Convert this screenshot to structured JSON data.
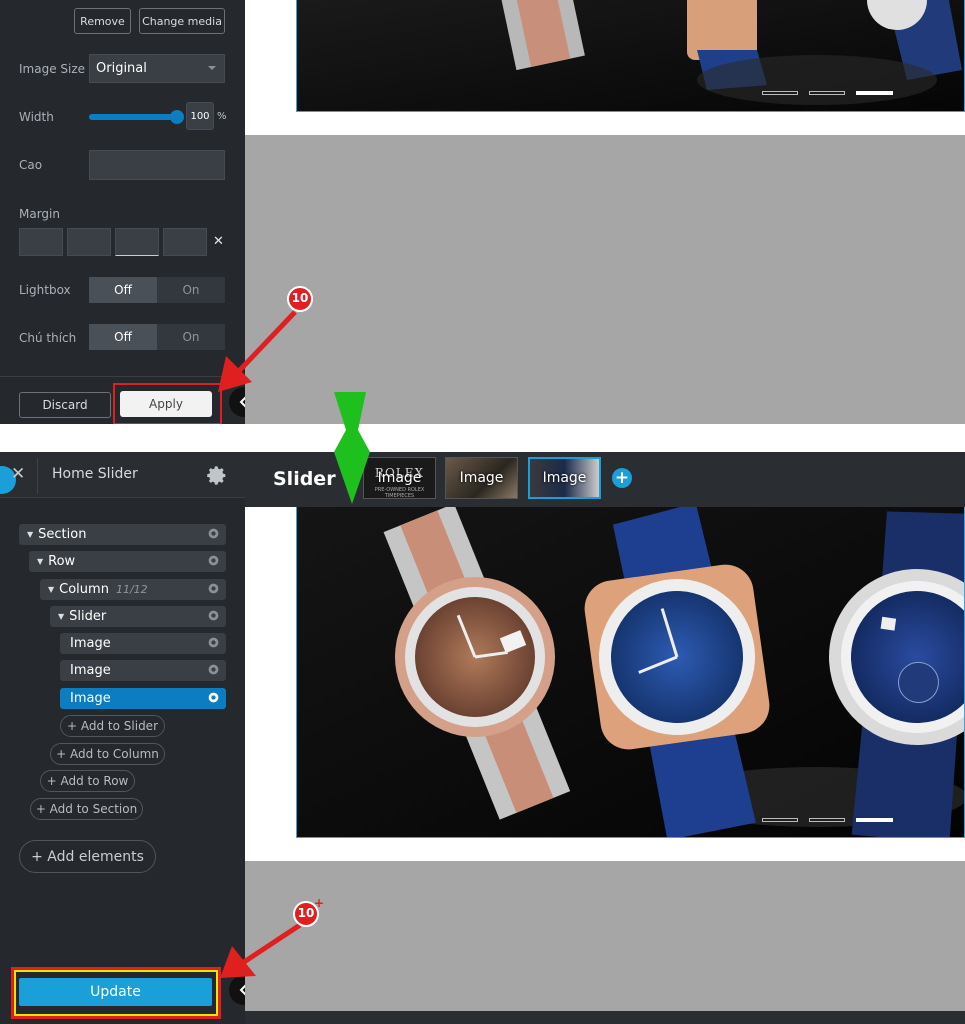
{
  "top_panel": {
    "remove_label": "Remove",
    "change_media_label": "Change media",
    "image_size_label": "Image Size",
    "image_size_value": "Original",
    "width_label": "Width",
    "width_value": "100",
    "width_unit": "%",
    "width_fraction": 1.0,
    "cao_label": "Cao",
    "margin_label": "Margin",
    "margin_clear": "✕",
    "lightbox_label": "Lightbox",
    "chu_thich_label": "Chú thích",
    "off_label": "Off",
    "on_label": "On",
    "discard_label": "Discard",
    "apply_label": "Apply"
  },
  "annotations": {
    "step_top": "10",
    "step_bottom": "10",
    "step_bottom_sup": "+"
  },
  "bottom_panel": {
    "close_icon": "✕",
    "title": "Home Slider",
    "tree": [
      {
        "label": "Section",
        "extra": ""
      },
      {
        "label": "Row",
        "extra": ""
      },
      {
        "label": "Column",
        "extra": "11/12"
      },
      {
        "label": "Slider",
        "extra": ""
      },
      {
        "label": "Image",
        "extra": ""
      },
      {
        "label": "Image",
        "extra": ""
      },
      {
        "label": "Image",
        "extra": ""
      }
    ],
    "add_to_slider": "+ Add to Slider",
    "add_to_column": "+ Add to Column",
    "add_to_row": "+ Add to Row",
    "add_to_section": "+ Add to Section",
    "add_elements": "+ Add elements",
    "update_label": "Update"
  },
  "slider_toolbar": {
    "title": "Slider",
    "thumbs": [
      "Image",
      "Image",
      "Image"
    ],
    "rolex_text": "ROLEX",
    "rolex_sub": "PRE-OWNED ROLEX TIMEPIECES"
  },
  "colors": {
    "accent": "#0b7dc0",
    "update_button": "#1a9fd9",
    "annotation_red": "#e02020",
    "annotation_green": "#1ec01e",
    "highlight_yellow": "#f2e600"
  }
}
